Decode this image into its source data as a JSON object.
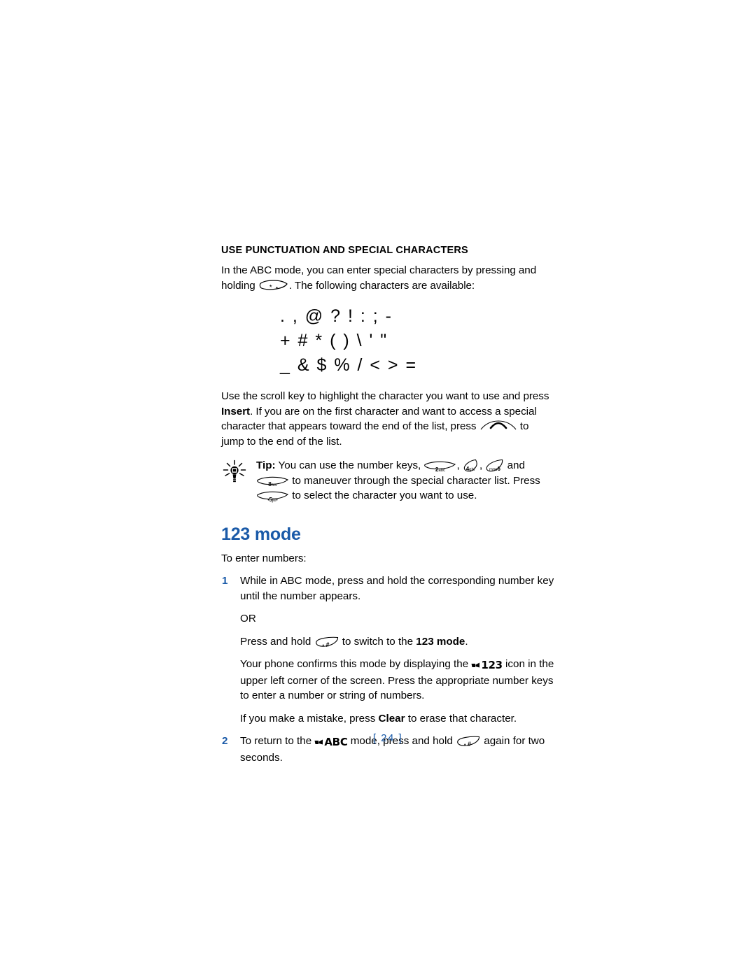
{
  "page": {
    "number_label": "[ 24 ]",
    "number": "24"
  },
  "section": {
    "heading": "USE PUNCTUATION AND SPECIAL CHARACTERS",
    "intro_part1": "In the ABC mode, you can enter special characters by pressing and holding",
    "intro_part2": ". The following characters are available:"
  },
  "special_characters": {
    "rows": [
      [
        ".",
        ",",
        "@",
        "?",
        "!",
        ":",
        ";",
        "-"
      ],
      [
        "+",
        "#",
        "*",
        "(",
        ")",
        "\\",
        "'",
        "\""
      ],
      [
        "_",
        "&",
        "$",
        "%",
        "/",
        "<",
        ">",
        "="
      ]
    ],
    "row1_text": ". , @ ? ! : ; -",
    "row2_text": "+ # * ( ) \\ ' \"",
    "row3_text": "_ & $ % / < > ="
  },
  "scroll_paragraph": {
    "part1": "Use the scroll key to highlight the character you want to use and press ",
    "bold1": "Insert",
    "part2": ". If you are on the first character and want to access a special character that appears toward the end of the list, press ",
    "part3": " to jump to the end of the list."
  },
  "tip": {
    "icon": "lightbulb-icon",
    "label": "Tip:",
    "part1": " You can use the number keys, ",
    "part2": ", ",
    "part3": ", ",
    "part4": " and ",
    "part5": " to maneuver through the special character list. Press ",
    "part6": " to select the character you want to use."
  },
  "mode123": {
    "heading": "123 mode",
    "lead": "To enter numbers:",
    "items": [
      {
        "num": "1",
        "text": "While in ABC mode, press and hold the corresponding number key until the number appears."
      },
      {
        "num": "2",
        "text_part1": "To return to the ",
        "screen_icon": "ABC",
        "text_part2": " mode, press and hold ",
        "text_part3": " again for two seconds."
      }
    ],
    "or_label": "OR",
    "press_hold": {
      "part1": "Press and hold ",
      "part2": " to switch to the ",
      "bold": "123 mode",
      "part3": "."
    },
    "confirm": {
      "part1": "Your phone confirms this mode by displaying the ",
      "screen_icon": "123",
      "part2": " icon in the upper left corner of the screen. Press the appropriate number keys to enter a number or string of numbers."
    },
    "mistake": {
      "part1": "If you make a mistake, press ",
      "bold": "Clear",
      "part2": " to erase that character."
    }
  },
  "keys": {
    "star": {
      "name": "star-key",
      "label": "*"
    },
    "hash": {
      "name": "hash-key",
      "label": "#"
    },
    "scroll_up": {
      "name": "scroll-up-key",
      "label": ""
    },
    "k2": {
      "name": "key-2abc",
      "digit": "2",
      "letters": "abc"
    },
    "k4": {
      "name": "key-4ghi",
      "digit": "4",
      "letters": "ghi"
    },
    "k6": {
      "name": "key-6mno",
      "digit": "6",
      "letters": "mno"
    },
    "k8": {
      "name": "key-8tuv",
      "digit": "8",
      "letters": "tuv"
    },
    "k5": {
      "name": "key-5jkl",
      "digit": "5",
      "letters": "jkl"
    }
  },
  "colors": {
    "accent_blue": "#1a5aa8",
    "text": "#000000",
    "background": "#ffffff"
  }
}
